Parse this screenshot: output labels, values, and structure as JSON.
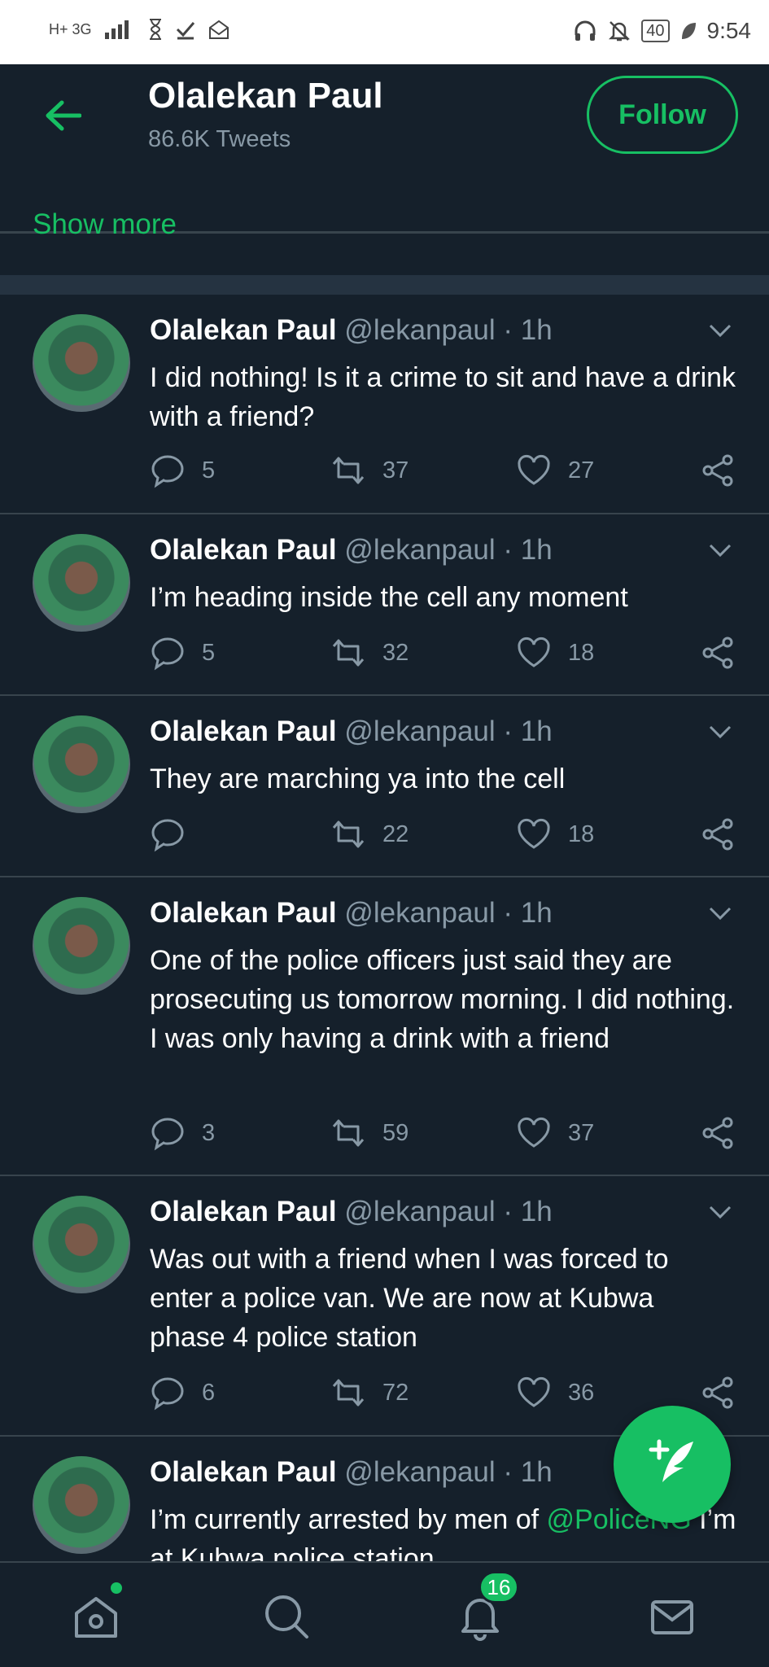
{
  "status_bar": {
    "left_indicators": "H+ 3G",
    "battery": "40",
    "time": "9:54"
  },
  "header": {
    "title": "Olalekan Paul",
    "subtitle": "86.6K Tweets",
    "follow_label": "Follow"
  },
  "show_more": "Show more",
  "tweets": [
    {
      "name": "Olalekan Paul",
      "handle": "@lekanpaul · 1h",
      "text": "I did nothing! Is it a crime to sit and have a drink with a friend?",
      "replies": "5",
      "retweets": "37",
      "likes": "27"
    },
    {
      "name": "Olalekan Paul",
      "handle": "@lekanpaul · 1h",
      "text": "I’m heading inside the cell any moment",
      "replies": "5",
      "retweets": "32",
      "likes": "18"
    },
    {
      "name": "Olalekan Paul",
      "handle": "@lekanpaul · 1h",
      "text": "They are marching ya into the cell",
      "replies": "",
      "retweets": "22",
      "likes": "18"
    },
    {
      "name": "Olalekan Paul",
      "handle": "@lekanpaul · 1h",
      "text": "One of the police officers just said they are prosecuting us tomorrow morning. I did nothing. I was only having a drink with a friend",
      "replies": "3",
      "retweets": "59",
      "likes": "37"
    },
    {
      "name": "Olalekan Paul",
      "handle": "@lekanpaul · 1h",
      "text": "Was out with a friend when I was forced to enter a police van. We are now at Kubwa phase 4 police station",
      "replies": "6",
      "retweets": "72",
      "likes": "36"
    },
    {
      "name": "Olalekan Paul",
      "handle": "@lekanpaul · 1h",
      "text_before": "I’m currently arrested by men of ",
      "mention": "@PoliceNG",
      "text_after": " I’m at Kubwa police station"
    }
  ],
  "bottom_nav": {
    "notifications_badge": "16"
  },
  "icons": {
    "back": "arrow-left-icon",
    "reply": "speech-bubble-icon",
    "retweet": "retweet-icon",
    "like": "heart-icon",
    "share": "share-icon",
    "compose": "feather-plus-icon",
    "home": "home-icon",
    "search": "search-icon",
    "notifications": "bell-icon",
    "messages": "mail-icon"
  },
  "colors": {
    "background": "#15202b",
    "accent": "#17bf63",
    "muted": "#8899a6",
    "divider": "#38444d"
  }
}
